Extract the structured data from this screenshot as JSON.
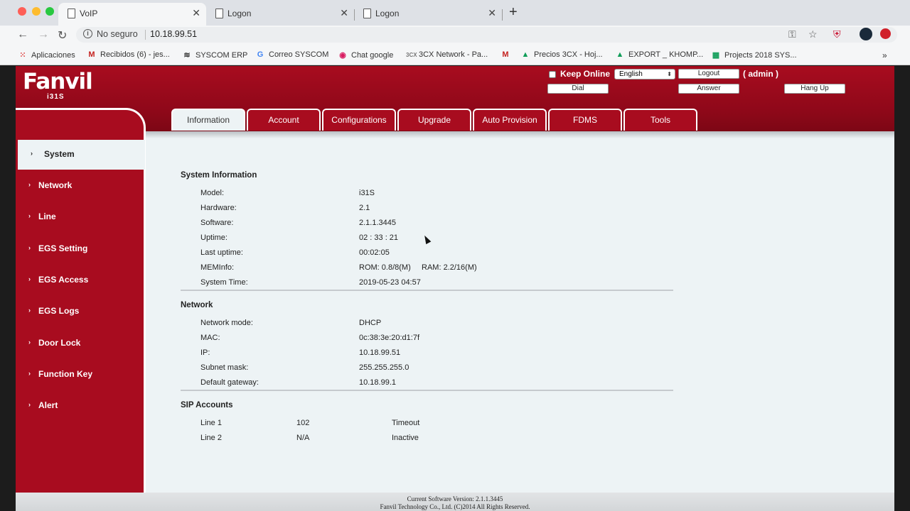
{
  "browser": {
    "tabs": [
      {
        "label": "VoIP",
        "active": true
      },
      {
        "label": "Logon",
        "active": false
      },
      {
        "label": "Logon",
        "active": false
      }
    ],
    "omnibox": {
      "security": "No seguro",
      "url": "10.18.99.51"
    },
    "bookmarks": [
      {
        "label": "Aplicaciones",
        "icon": "apps-grid-icon"
      },
      {
        "label": "Recibidos (6) - jes...",
        "icon": "gmail-icon"
      },
      {
        "label": "SYSCOM ERP",
        "icon": "syscom-icon"
      },
      {
        "label": "Correo SYSCOM",
        "icon": "google-icon"
      },
      {
        "label": "Chat google",
        "icon": "chat-icon"
      },
      {
        "label": "3CX Network - Pa...",
        "icon": "3cx-icon"
      },
      {
        "label": "",
        "icon": "gmail-icon"
      },
      {
        "label": "Precios 3CX - Hoj...",
        "icon": "drive-icon"
      },
      {
        "label": "EXPORT _ KHOMP...",
        "icon": "drive-icon"
      },
      {
        "label": "Projects 2018 SYS...",
        "icon": "sheets-icon"
      }
    ]
  },
  "header": {
    "logo": "Fanvil",
    "model": "i31S",
    "keep_online": "Keep Online",
    "language": "English",
    "logout": "Logout",
    "user": "( admin )",
    "dial": "Dial",
    "answer": "Answer",
    "hang_up": "Hang Up"
  },
  "tabs": [
    "Information",
    "Account",
    "Configurations",
    "Upgrade",
    "Auto Provision",
    "FDMS",
    "Tools"
  ],
  "sidebar": [
    "System",
    "Network",
    "Line",
    "EGS Setting",
    "EGS Access",
    "EGS Logs",
    "Door Lock",
    "Function Key",
    "Alert"
  ],
  "system_info": {
    "title": "System Information",
    "rows": [
      {
        "label": "Model:",
        "value": "i31S"
      },
      {
        "label": "Hardware:",
        "value": "2.1"
      },
      {
        "label": "Software:",
        "value": "2.1.1.3445"
      },
      {
        "label": "Uptime:",
        "value": "02 : 33 : 21"
      },
      {
        "label": "Last uptime:",
        "value": "00:02:05"
      },
      {
        "label": "MEMInfo:",
        "value": "ROM: 0.8/8(M)     RAM: 2.2/16(M)"
      },
      {
        "label": "System Time:",
        "value": "2019-05-23 04:57"
      }
    ]
  },
  "network_info": {
    "title": "Network",
    "rows": [
      {
        "label": "Network mode:",
        "value": "DHCP"
      },
      {
        "label": "MAC:",
        "value": "0c:38:3e:20:d1:7f"
      },
      {
        "label": "IP:",
        "value": "10.18.99.51"
      },
      {
        "label": "Subnet mask:",
        "value": "255.255.255.0"
      },
      {
        "label": "Default gateway:",
        "value": "10.18.99.1"
      }
    ]
  },
  "sip_accounts": {
    "title": "SIP Accounts",
    "rows": [
      {
        "line": "Line 1",
        "number": "102",
        "status": "Timeout"
      },
      {
        "line": "Line 2",
        "number": "N/A",
        "status": "Inactive"
      }
    ]
  },
  "footer": {
    "line1": "Current Software Version: 2.1.1.3445",
    "line2": "Fanvil Technology Co., Ltd. (C)2014 All Rights Reserved."
  },
  "colors": {
    "brand_red": "#a80c1f",
    "page_bg": "#edf3f5"
  }
}
